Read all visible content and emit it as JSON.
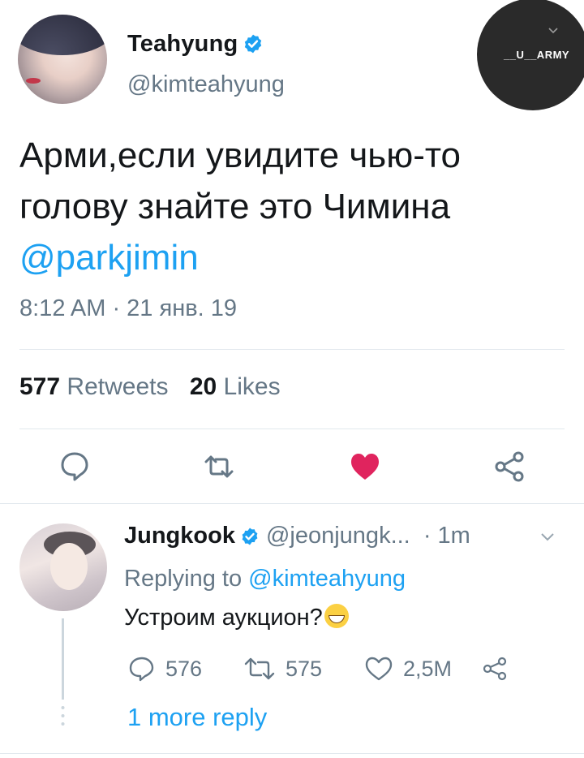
{
  "main_tweet": {
    "display_name": "Teahyung",
    "handle": "@kimteahyung",
    "text_line1": "Арми,если увидите чью-то",
    "text_line2": "голову знайте это Чимина",
    "mention": "@parkjimin",
    "timestamp": "8:12 AM · 21 янв. 19",
    "retweets_count": "577",
    "retweets_label": "Retweets",
    "likes_count": "20",
    "likes_label": "Likes"
  },
  "watermark": {
    "text": "__U__ARMY"
  },
  "reply": {
    "display_name": "Jungkook",
    "handle": "@jeonjungk...",
    "time": "· 1m",
    "replying_prefix": "Replying to",
    "replying_to": "@kimteahyung",
    "text": "Устроим аукцион?",
    "reply_count": "576",
    "retweet_count": "575",
    "like_count": "2,5M",
    "more_replies": "1 more reply"
  },
  "icons": {
    "verified": "verified-badge-icon",
    "reply": "speech-bubble-icon",
    "retweet": "retweet-arrows-icon",
    "like": "heart-icon",
    "share": "share-icon",
    "emoji": "grinning-sweat-emoji"
  },
  "colors": {
    "accent": "#1da1f2",
    "like_active": "#e0245e",
    "secondary_text": "#657786",
    "divider": "#e1e8ed"
  }
}
